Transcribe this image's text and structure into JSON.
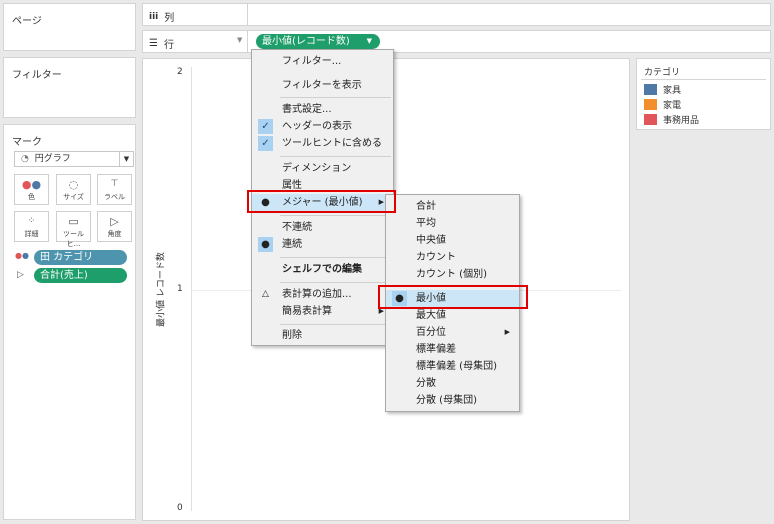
{
  "left_panel": {
    "pages_title": "ページ",
    "filters_title": "フィルター",
    "marks_title": "マーク",
    "mark_type": "円グラフ",
    "mark_buttons": [
      {
        "label": "色",
        "icon": "color-dots-icon"
      },
      {
        "label": "サイズ",
        "icon": "size-icon"
      },
      {
        "label": "ラベル",
        "icon": "label-icon"
      },
      {
        "label": "詳細",
        "icon": "detail-icon"
      },
      {
        "label": "ツールヒ...",
        "icon": "tooltip-icon"
      },
      {
        "label": "角度",
        "icon": "angle-icon"
      }
    ],
    "mark_pills": [
      {
        "label": "田 カテゴリ",
        "color": "#4e94ae"
      },
      {
        "label": "合計(売上)",
        "color": "#1e9e6a"
      }
    ]
  },
  "shelves": {
    "columns_label": "列",
    "rows_label": "行",
    "rows_pill": "最小値(レコード数)"
  },
  "view": {
    "axis_title": "最小値 レコード数",
    "axis_ticks": [
      "2",
      "1",
      "0"
    ]
  },
  "legend": {
    "title": "カテゴリ",
    "items": [
      {
        "label": "家具",
        "color": "#4e79a7"
      },
      {
        "label": "家電",
        "color": "#f28e2b"
      },
      {
        "label": "事務用品",
        "color": "#e15759"
      }
    ]
  },
  "context_menu": {
    "items": [
      {
        "label": "フィルター..."
      },
      {
        "label": "フィルターを表示"
      },
      {
        "label": "書式設定..."
      },
      {
        "label": "ヘッダーの表示",
        "checked": true
      },
      {
        "label": "ツールヒントに含める",
        "checked": true
      },
      {
        "label": "ディメンション"
      },
      {
        "label": "属性"
      },
      {
        "label": "メジャー (最小値)",
        "bullet": true,
        "submenu": true
      },
      {
        "label": "不連続"
      },
      {
        "label": "連続",
        "bullet": true
      },
      {
        "label": "シェルフでの編集"
      },
      {
        "label": "表計算の追加..."
      },
      {
        "label": "簡易表計算",
        "submenu": true
      },
      {
        "label": "削除"
      }
    ]
  },
  "measure_submenu": {
    "items": [
      {
        "label": "合計"
      },
      {
        "label": "平均"
      },
      {
        "label": "中央値"
      },
      {
        "label": "カウント"
      },
      {
        "label": "カウント (個別)"
      },
      {
        "label": "最小値",
        "bullet": true
      },
      {
        "label": "最大値"
      },
      {
        "label": "百分位",
        "submenu": true
      },
      {
        "label": "標準偏差"
      },
      {
        "label": "標準偏差 (母集団)"
      },
      {
        "label": "分散"
      },
      {
        "label": "分散 (母集団)"
      }
    ]
  }
}
